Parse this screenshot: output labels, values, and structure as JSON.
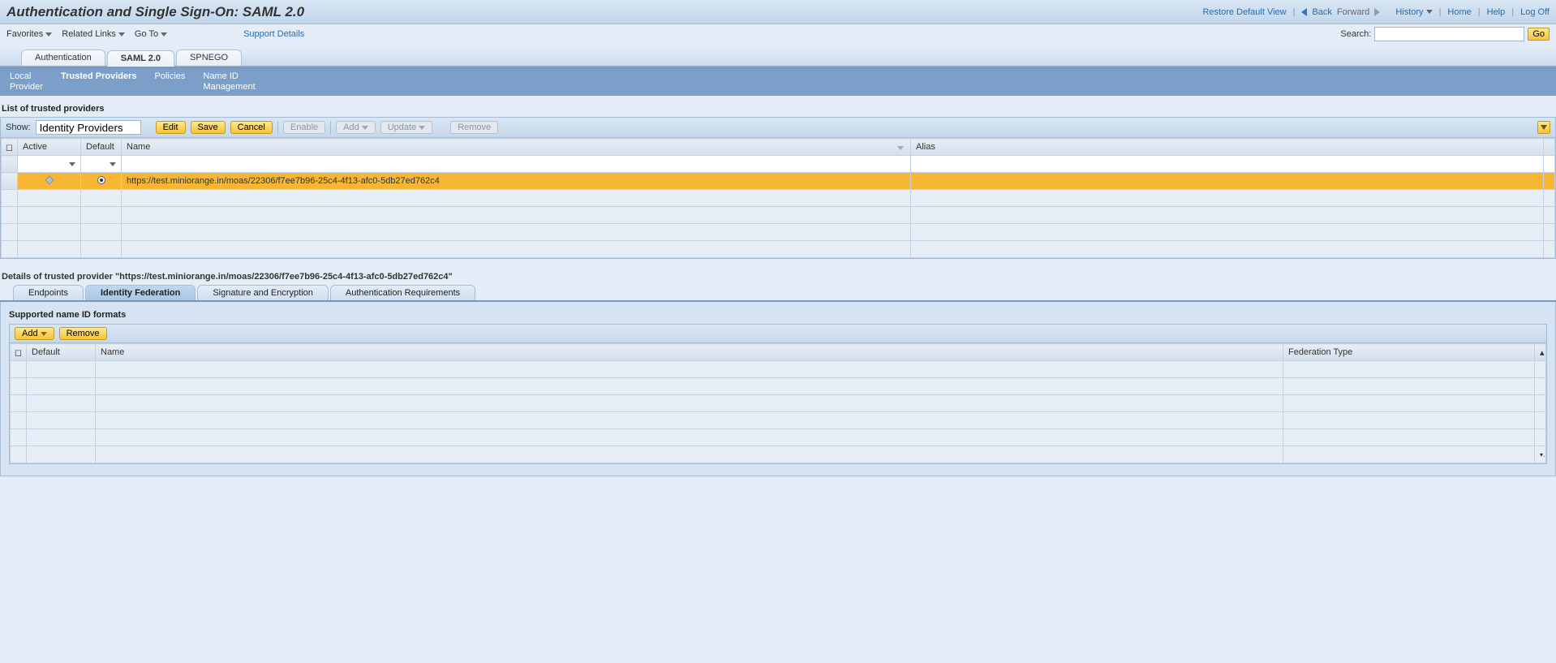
{
  "header": {
    "title": "Authentication and Single Sign-On: SAML 2.0",
    "links": {
      "restore": "Restore Default View",
      "back": "Back",
      "forward": "Forward",
      "history": "History",
      "home": "Home",
      "help": "Help",
      "logoff": "Log Off"
    }
  },
  "subbar": {
    "menus": {
      "favorites": "Favorites",
      "related": "Related Links",
      "goto": "Go To"
    },
    "support": "Support Details",
    "search_label": "Search:",
    "search_value": "",
    "go": "Go"
  },
  "tabs": {
    "auth": "Authentication",
    "saml": "SAML 2.0",
    "spnego": "SPNEGO"
  },
  "subnav": {
    "local1": "Local",
    "local2": "Provider",
    "trusted": "Trusted Providers",
    "policies": "Policies",
    "nameid1": "Name ID",
    "nameid2": "Management"
  },
  "providers": {
    "heading": "List of trusted providers",
    "show_label": "Show:",
    "show_value": "Identity Providers",
    "buttons": {
      "edit": "Edit",
      "save": "Save",
      "cancel": "Cancel",
      "enable": "Enable",
      "add": "Add",
      "update": "Update",
      "remove": "Remove"
    },
    "columns": {
      "active": "Active",
      "default": "Default",
      "name": "Name",
      "alias": "Alias"
    },
    "row": {
      "name": "https://test.miniorange.in/moas/22306/f7ee7b96-25c4-4f13-afc0-5db27ed762c4",
      "alias": ""
    }
  },
  "details": {
    "heading": "Details of trusted provider \"https://test.miniorange.in/moas/22306/f7ee7b96-25c4-4f13-afc0-5db27ed762c4\"",
    "tabs": {
      "endpoints": "Endpoints",
      "idfed": "Identity Federation",
      "sig": "Signature and Encryption",
      "authreq": "Authentication Requirements"
    },
    "nameid": {
      "heading": "Supported name ID formats",
      "buttons": {
        "add": "Add",
        "remove": "Remove"
      },
      "columns": {
        "default": "Default",
        "name": "Name",
        "fed": "Federation Type"
      }
    }
  }
}
